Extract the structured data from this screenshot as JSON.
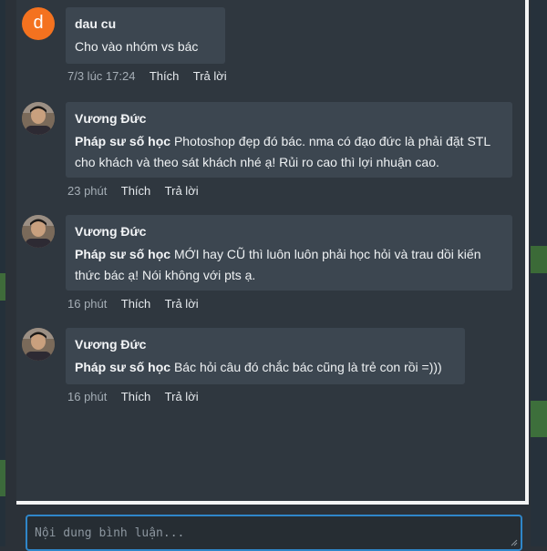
{
  "comments": [
    {
      "avatar_letter": "d",
      "author": "dau cu",
      "mention": "",
      "text": "Cho vào nhóm vs bác",
      "time": "7/3 lúc 17:24",
      "like": "Thích",
      "reply": "Trả lời"
    },
    {
      "author": "Vương Đức",
      "mention": "Pháp sư số học",
      "text": "Photoshop đẹp đó bác. nma có đạo đức là phải đặt STL cho khách và theo sát khách nhé ạ! Rủi ro cao thì lợi nhuận cao.",
      "time": "23 phút",
      "like": "Thích",
      "reply": "Trả lời"
    },
    {
      "author": "Vương Đức",
      "mention": "Pháp sư số học",
      "text": "MỚI hay CŨ thì luôn luôn phải học hỏi và trau dồi kiến thức bác ạ! Nói không với pts ạ.",
      "time": "16 phút",
      "like": "Thích",
      "reply": "Trả lời"
    },
    {
      "author": "Vương Đức",
      "mention": "Pháp sư số học",
      "text": "Bác hỏi câu đó chắc bác cũng là trẻ con rồi =)))",
      "time": "16 phút",
      "like": "Thích",
      "reply": "Trả lời"
    }
  ],
  "comment_input": {
    "placeholder": "Nội dung bình luận..."
  }
}
